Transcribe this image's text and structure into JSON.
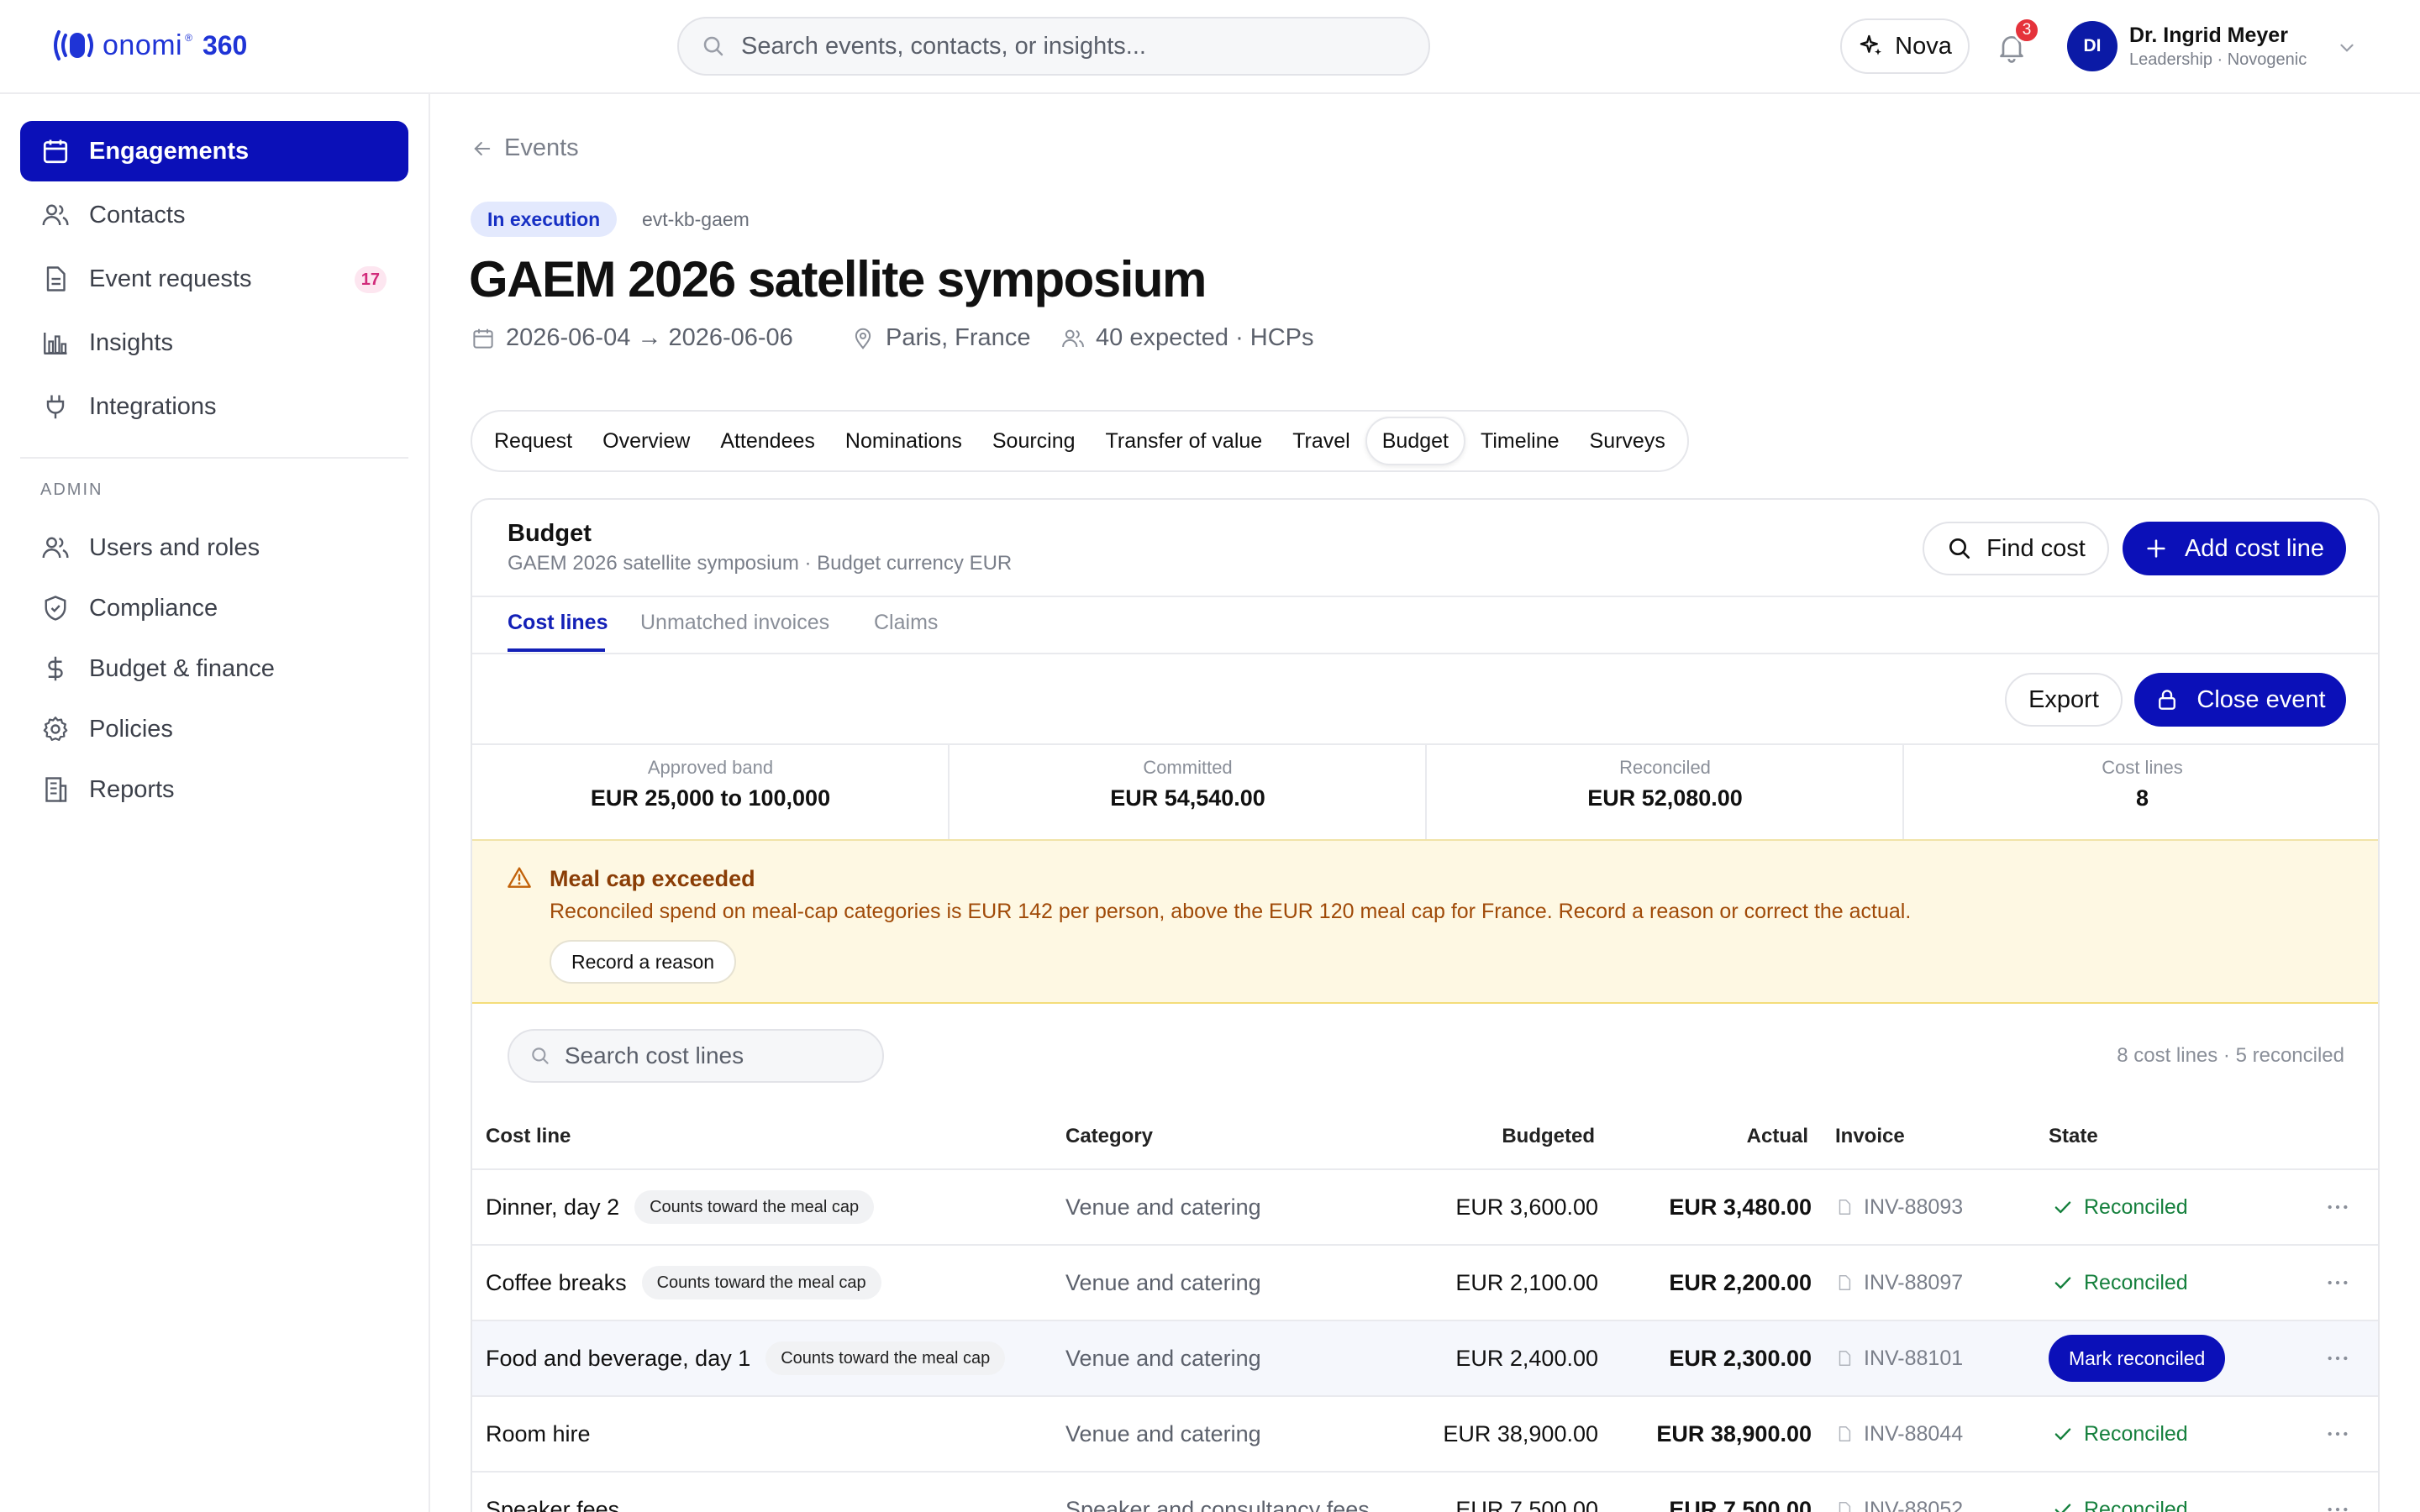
{
  "brand": {
    "word": "onomi",
    "suffix": "360",
    "color": "#1f34d6"
  },
  "search": {
    "placeholder": "Search events, contacts, or insights..."
  },
  "header": {
    "assistant_label": "Nova",
    "notifications_count": "3",
    "user": {
      "initials": "DI",
      "name": "Dr. Ingrid Meyer",
      "role": "Leadership · Novogenic"
    }
  },
  "sidebar": {
    "items": [
      {
        "label": "Engagements",
        "icon": "calendar-icon",
        "active": true
      },
      {
        "label": "Contacts",
        "icon": "users-icon"
      },
      {
        "label": "Event requests",
        "icon": "document-icon",
        "count": "17"
      },
      {
        "label": "Insights",
        "icon": "bar-chart-icon"
      },
      {
        "label": "Integrations",
        "icon": "plug-icon"
      }
    ],
    "admin_title": "ADMIN",
    "admin_items": [
      {
        "label": "Users and roles",
        "icon": "users-icon"
      },
      {
        "label": "Compliance",
        "icon": "shield-icon"
      },
      {
        "label": "Budget & finance",
        "icon": "dollar-icon"
      },
      {
        "label": "Policies",
        "icon": "gear-icon"
      },
      {
        "label": "Reports",
        "icon": "building-icon"
      }
    ]
  },
  "event": {
    "back_label": "Events",
    "status": "In execution",
    "id": "evt-kb-gaem",
    "title": "GAEM 2026 satellite symposium",
    "dates": "2026-06-04 → 2026-06-06",
    "location": "Paris, France",
    "attendance": "40 expected · HCPs",
    "tabs": [
      "Request",
      "Overview",
      "Attendees",
      "Nominations",
      "Sourcing",
      "Transfer of value",
      "Travel",
      "Budget",
      "Timeline",
      "Surveys"
    ],
    "active_tab": "Budget"
  },
  "budget": {
    "title": "Budget",
    "subtitle": "GAEM 2026 satellite symposium · Budget currency EUR",
    "find_label": "Find cost",
    "add_label": "Add cost line",
    "subtabs": [
      "Cost lines",
      "Unmatched invoices",
      "Claims"
    ],
    "export_label": "Export",
    "close_label": "Close event",
    "stats": [
      {
        "label": "Approved band",
        "value": "EUR 25,000 to 100,000"
      },
      {
        "label": "Committed",
        "value": "EUR 54,540.00"
      },
      {
        "label": "Reconciled",
        "value": "EUR 52,080.00"
      },
      {
        "label": "Cost lines",
        "value": "8"
      }
    ],
    "alert": {
      "title": "Meal cap exceeded",
      "text": "Reconciled spend on meal-cap categories is EUR 142 per person, above the EUR 120 meal cap for France. Record a reason or correct the actual.",
      "action": "Record a reason"
    },
    "search_placeholder": "Search cost lines",
    "summary": "8 cost lines · 5 reconciled",
    "columns": [
      "Cost line",
      "Category",
      "Budgeted",
      "Actual",
      "Invoice",
      "State"
    ],
    "rows": [
      {
        "name": "Dinner, day 2",
        "tag": "Counts toward the meal cap",
        "category": "Venue and catering",
        "budgeted": "EUR 3,600.00",
        "actual": "EUR 3,480.00",
        "invoice": "INV-88093",
        "state": "Reconciled"
      },
      {
        "name": "Coffee breaks",
        "tag": "Counts toward the meal cap",
        "category": "Venue and catering",
        "budgeted": "EUR 2,100.00",
        "actual": "EUR 2,200.00",
        "invoice": "INV-88097",
        "state": "Reconciled"
      },
      {
        "name": "Food and beverage, day 1",
        "tag": "Counts toward the meal cap",
        "category": "Venue and catering",
        "budgeted": "EUR 2,400.00",
        "actual": "EUR 2,300.00",
        "invoice": "INV-88101",
        "state_action": "Mark reconciled"
      },
      {
        "name": "Room hire",
        "category": "Venue and catering",
        "budgeted": "EUR 38,900.00",
        "actual": "EUR 38,900.00",
        "invoice": "INV-88044",
        "state": "Reconciled"
      },
      {
        "name": "Speaker fees",
        "category": "Speaker and consultancy fees",
        "budgeted": "EUR 7,500.00",
        "actual": "EUR 7,500.00",
        "invoice": "INV-88052",
        "state": "Reconciled"
      }
    ]
  }
}
